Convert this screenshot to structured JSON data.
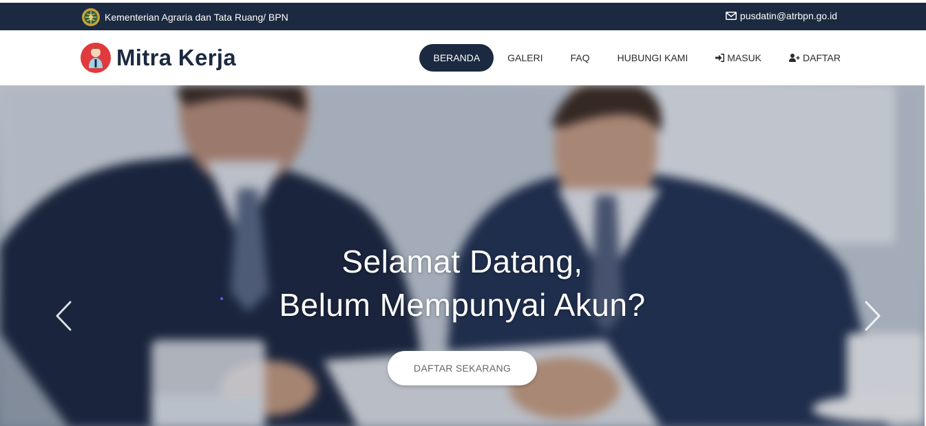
{
  "topbar": {
    "org_name": "Kementerian Agraria dan Tata Ruang/ BPN",
    "email": "pusdatin@atrbpn.go.id",
    "org_icon": "bpn-emblem-icon",
    "mail_icon": "envelope-icon"
  },
  "brand": {
    "name": "Mitra Kerja",
    "logo_icon": "mitra-kerja-logo-icon"
  },
  "nav": {
    "items": [
      {
        "label": "BERANDA",
        "active": true
      },
      {
        "label": "GALERI"
      },
      {
        "label": "FAQ"
      },
      {
        "label": "HUBUNGI KAMI"
      },
      {
        "label": "MASUK",
        "icon": "sign-in-icon"
      },
      {
        "label": "DAFTAR",
        "icon": "user-plus-icon"
      }
    ]
  },
  "hero": {
    "title_line1": "Selamat Datang,",
    "title_line2": "Belum Mempunyai Akun?",
    "cta_label": "DAFTAR SEKARANG",
    "prev_icon": "chevron-left-icon",
    "next_icon": "chevron-right-icon"
  },
  "colors": {
    "navy": "#1b2a41",
    "white": "#ffffff",
    "logo_red": "#e03a3e"
  }
}
